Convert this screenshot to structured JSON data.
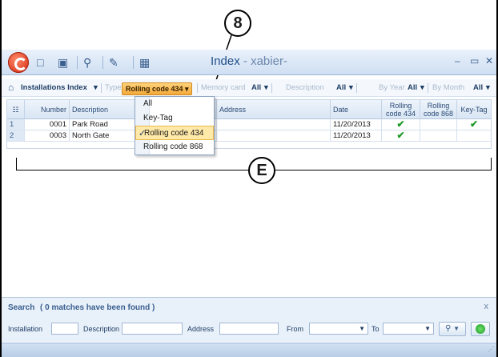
{
  "callouts": {
    "top": "8",
    "bracket": "E"
  },
  "window": {
    "title_main": "Index",
    "title_sub": " - xabier-",
    "min_icon": "–",
    "max_icon": "▭",
    "close_icon": "✕"
  },
  "quick_access": [
    "new-document-icon",
    "open-icon",
    "search-icon",
    "transmit-icon",
    "calculator-icon"
  ],
  "toolbar": {
    "installations_label": "Installations Index",
    "type_label": "Type",
    "rolling_code_selected": "Rolling code 434",
    "memory_card_label": "Memory card",
    "memory_card_value": "All",
    "description_label": "Description",
    "description_value": "All",
    "year_label": "By Year",
    "year_value": "All",
    "month_label": "By Month",
    "month_value": "All",
    "dropdown_arrow": "▾"
  },
  "type_dropdown": {
    "items": [
      "All",
      "Key-Tag",
      "Rolling code 434",
      "Rolling code 868"
    ],
    "selected_index": 2,
    "tick": "✓"
  },
  "grid": {
    "columns": [
      "Number",
      "Description",
      "Address",
      "Date",
      "Rolling code 434",
      "Rolling code 868",
      "Key-Tag"
    ],
    "rows": [
      {
        "index": "1",
        "number": "0001",
        "description": "Park Road",
        "address": "",
        "date": "11/20/2013",
        "rc434": true,
        "rc868": false,
        "keytag": true
      },
      {
        "index": "2",
        "number": "0003",
        "description": "North Gate",
        "address": "",
        "date": "11/20/2013",
        "rc434": true,
        "rc868": false,
        "keytag": false
      }
    ],
    "check_glyph": "✔"
  },
  "search": {
    "title": "Search",
    "count_text": "( 0 matches have been found )",
    "close": "x",
    "installation_label": "Installation",
    "description_label": "Description",
    "address_label": "Address",
    "from_label": "From",
    "to_label": "To",
    "installation_value": "",
    "description_value": "",
    "address_value": "",
    "from_value": "",
    "to_value": ""
  }
}
